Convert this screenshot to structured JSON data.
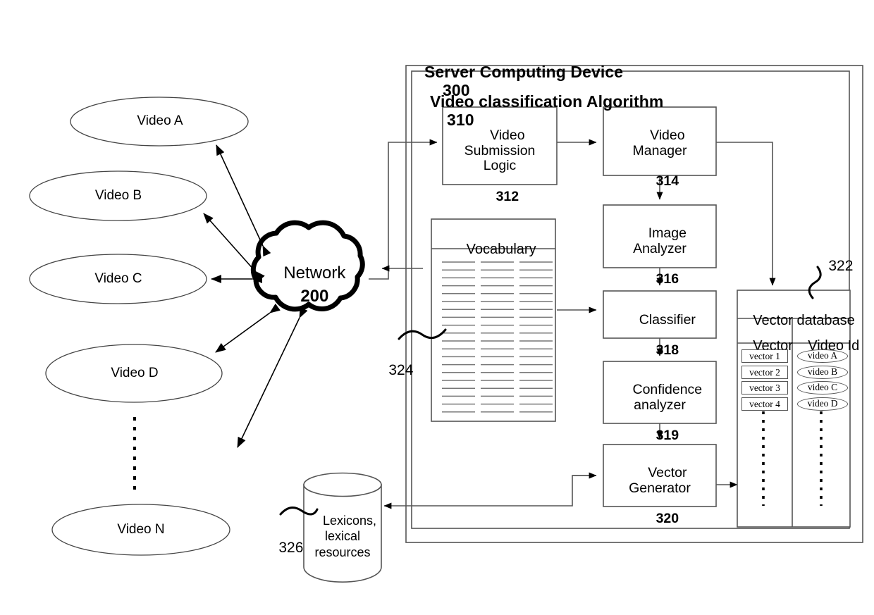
{
  "diagram": {
    "type": "patent-block-diagram",
    "server": {
      "title": "Server Computing Device",
      "ref": "300"
    },
    "algorithm": {
      "title": "Video classification Algorithm",
      "ref": "310"
    },
    "network": {
      "label": "Network",
      "ref": "200"
    },
    "videos": [
      {
        "label": "Video A"
      },
      {
        "label": "Video B"
      },
      {
        "label": "Video C"
      },
      {
        "label": "Video D"
      },
      {
        "label": "Video N"
      }
    ],
    "process_boxes": [
      {
        "label": "Video\nSubmission\nLogic",
        "ref": "312"
      },
      {
        "label": "Video\nManager",
        "ref": "314"
      },
      {
        "label": "Image\nAnalyzer",
        "ref": "316"
      },
      {
        "label": "Classifier",
        "ref": "318"
      },
      {
        "label": "Confidence\nanalyzer",
        "ref": "319"
      },
      {
        "label": "Vector\nGenerator",
        "ref": "320"
      }
    ],
    "vocabulary": {
      "title": "Vocabulary",
      "ref": "324",
      "columns": 3,
      "rows": 20
    },
    "vector_database": {
      "title": "Vector database",
      "ref": "322",
      "columns": [
        "Vector",
        "Video Id"
      ],
      "rows": [
        {
          "vector": "vector 1",
          "video": "video A"
        },
        {
          "vector": "vector 2",
          "video": "video B"
        },
        {
          "vector": "vector 3",
          "video": "video C"
        },
        {
          "vector": "vector 4",
          "video": "video D"
        }
      ],
      "continuation": "vertical-dots"
    },
    "lexicons": {
      "label": "Lexicons,\nlexical\nresources",
      "ref": "326"
    },
    "colors": {
      "stroke": "#000000",
      "thin_stroke": "#555555",
      "background": "#ffffff"
    }
  }
}
